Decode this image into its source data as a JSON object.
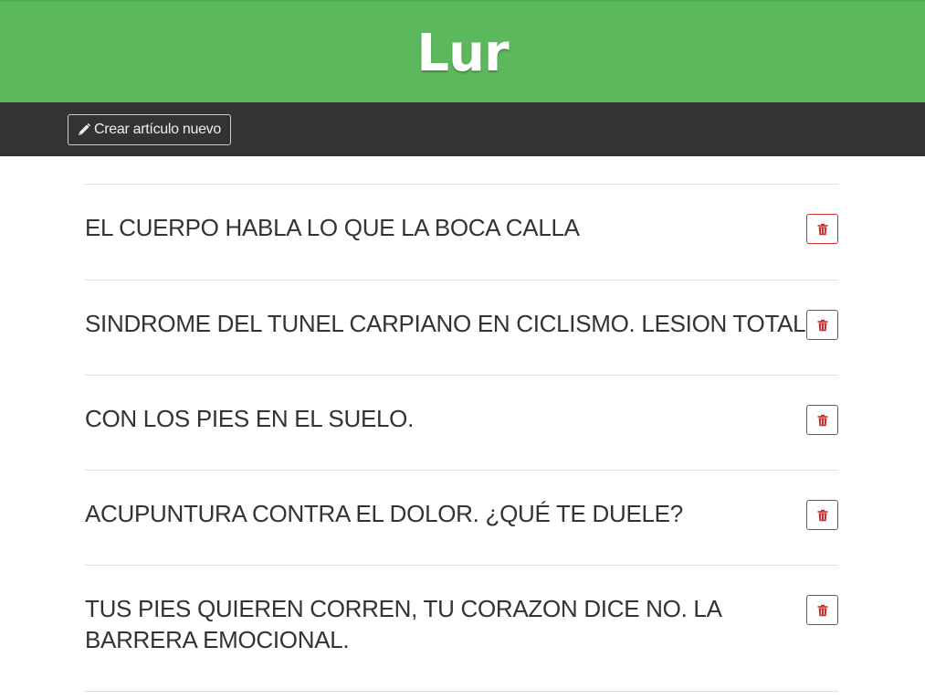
{
  "header": {
    "brand": "Lur"
  },
  "navbar": {
    "new_article_label": "Crear artículo nuevo",
    "new_article_icon": "pencil-icon"
  },
  "articles": [
    {
      "title": "EL CUERPO HABLA LO QUE LA BOCA CALLA",
      "delete_icon": "trash-icon"
    },
    {
      "title": "SINDROME DEL TUNEL CARPIANO EN CICLISMO. LESION TOTAL",
      "delete_icon": "trash-icon"
    },
    {
      "title": "CON LOS PIES EN EL SUELO.",
      "delete_icon": "trash-icon"
    },
    {
      "title": "ACUPUNTURA CONTRA EL DOLOR. ¿QUÉ TE DUELE?",
      "delete_icon": "trash-icon"
    },
    {
      "title": "TUS PIES QUIEREN CORREN, TU CORAZON DICE NO. LA BARRERA EMOCIONAL.",
      "delete_icon": "trash-icon"
    }
  ],
  "colors": {
    "header_bg": "#5cb85c",
    "navbar_bg": "#333333",
    "danger": "#c9302c",
    "text": "#333333"
  }
}
